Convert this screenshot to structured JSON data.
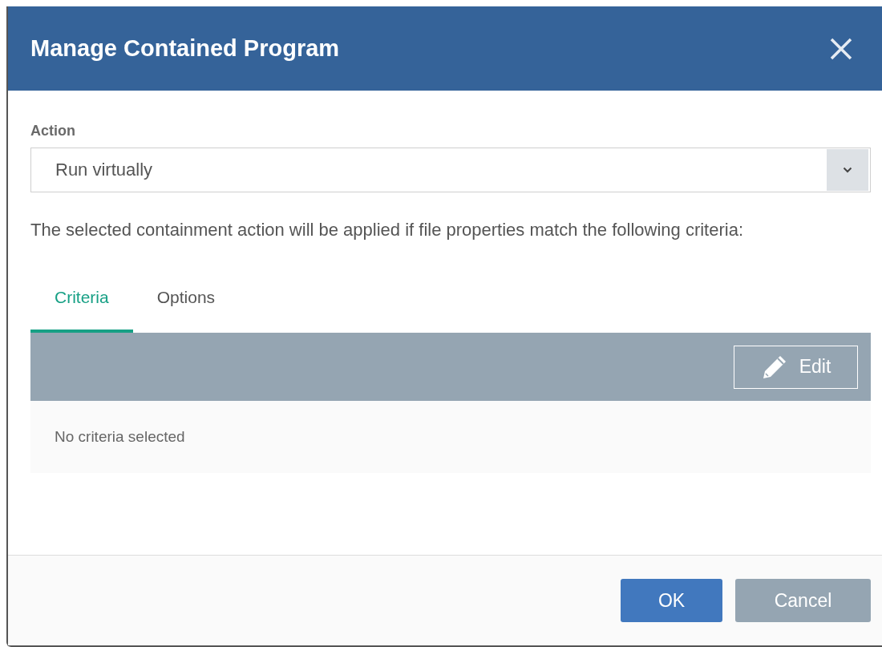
{
  "dialog": {
    "title": "Manage Contained Program"
  },
  "action": {
    "label": "Action",
    "value": "Run virtually"
  },
  "description": "The selected containment action will be applied if file properties match the following criteria:",
  "tabs": [
    {
      "label": "Criteria",
      "selected": true
    },
    {
      "label": "Options",
      "selected": false
    }
  ],
  "toolbar": {
    "edit_button": "Edit"
  },
  "empty_message": "No criteria selected",
  "buttons": [
    {
      "label": "OK",
      "kind": "primary"
    },
    {
      "label": "Cancel",
      "kind": "secondary"
    }
  ]
}
